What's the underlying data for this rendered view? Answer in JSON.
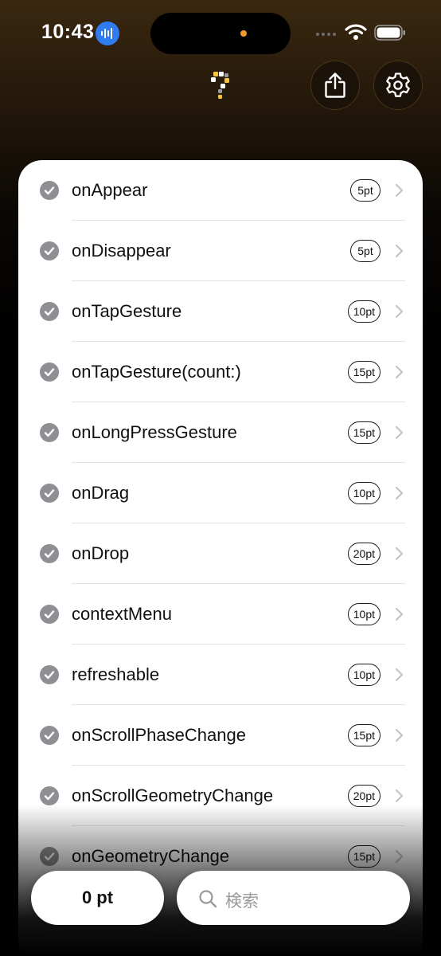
{
  "status_bar": {
    "time": "10:43"
  },
  "toolbar": {
    "logo_icon": "app-logo-icon",
    "share_icon": "share-icon",
    "settings_icon": "gear-icon"
  },
  "items": [
    {
      "label": "onAppear",
      "badge": "5pt"
    },
    {
      "label": "onDisappear",
      "badge": "5pt"
    },
    {
      "label": "onTapGesture",
      "badge": "10pt"
    },
    {
      "label": "onTapGesture(count:)",
      "badge": "15pt"
    },
    {
      "label": "onLongPressGesture",
      "badge": "15pt"
    },
    {
      "label": "onDrag",
      "badge": "10pt"
    },
    {
      "label": "onDrop",
      "badge": "20pt"
    },
    {
      "label": "contextMenu",
      "badge": "10pt"
    },
    {
      "label": "refreshable",
      "badge": "10pt"
    },
    {
      "label": "onScrollPhaseChange",
      "badge": "15pt"
    },
    {
      "label": "onScrollGeometryChange",
      "badge": "20pt"
    },
    {
      "label": "onGeometryChange",
      "badge": "15pt"
    }
  ],
  "bottom_bar": {
    "points": "0 pt",
    "search_placeholder": "検索"
  },
  "colors": {
    "accent_orange": "#f29a2e",
    "record_blue": "#2f7cf0",
    "check_gray": "#8e8e93"
  }
}
